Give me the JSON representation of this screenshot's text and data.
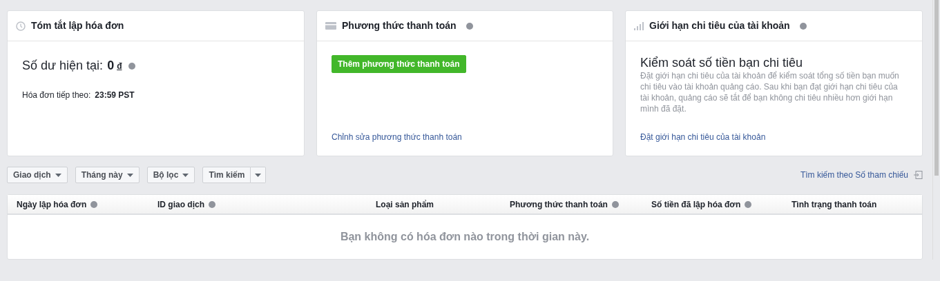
{
  "cards": [
    {
      "kind": "billing",
      "title": "Tóm tắt lập hóa đơn",
      "info": false,
      "balance_label": "Số dư hiện tại:",
      "balance_value": "0",
      "currency": "đ",
      "next_label": "Hóa đơn tiếp theo:",
      "next_value": "23:59 PST"
    },
    {
      "kind": "payment",
      "title": "Phương thức thanh toán",
      "info": true,
      "button": "Thêm phương thức thanh toán",
      "link": "Chỉnh sửa phương thức thanh toán"
    },
    {
      "kind": "limit",
      "title": "Giới hạn chi tiêu của tài khoản",
      "info": true,
      "heading": "Kiểm soát số tiền bạn chi tiêu",
      "description": "Đặt giới hạn chi tiêu của tài khoản để kiểm soát tổng số tiền bạn muốn chi tiêu vào tài khoản quảng cáo. Sau khi bạn đạt giới hạn chi tiêu của tài khoản, quảng cáo sẽ tắt để bạn không chi tiêu nhiều hơn giới hạn mình đã đặt.",
      "link": "Đặt giới hạn chi tiêu của tài khoản"
    }
  ],
  "filters": [
    {
      "kind": "dropdown",
      "label": "Giao dịch"
    },
    {
      "kind": "dropdown",
      "label": "Tháng này"
    },
    {
      "kind": "dropdown",
      "label": "Bộ lọc"
    },
    {
      "kind": "split",
      "label": "Tìm kiếm"
    }
  ],
  "reference_search": "Tìm kiếm theo Số tham chiếu",
  "table": {
    "columns": [
      {
        "label": "Ngày lập hóa đơn",
        "info": true
      },
      {
        "label": "ID giao dịch",
        "info": true
      },
      {
        "label": "Loại sản phẩm",
        "info": false
      },
      {
        "label": "Phương thức thanh toán",
        "info": true
      },
      {
        "label": "Số tiền đã lập hóa đơn",
        "info": true
      },
      {
        "label": "Tình trạng thanh toán",
        "info": false
      }
    ],
    "empty_message": "Bạn không có hóa đơn nào trong thời gian này."
  }
}
